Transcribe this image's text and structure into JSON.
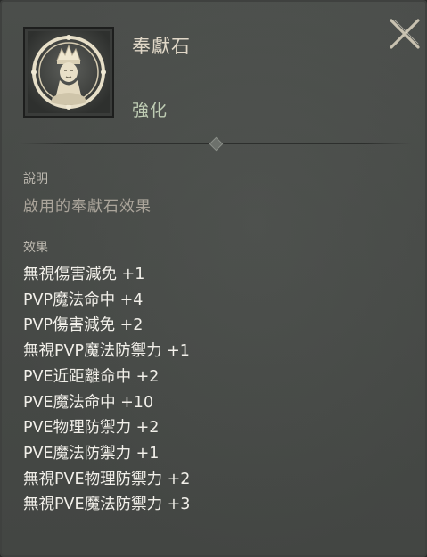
{
  "tooltip": {
    "item_name": "奉獻石",
    "item_type": "強化",
    "icon": "priest-portrait-icon",
    "close_icon": "close-icon",
    "description_label": "說明",
    "description_text": "啟用的奉獻石效果",
    "effects_label": "效果",
    "effects": [
      "無視傷害減免 +1",
      "PVP魔法命中 +4",
      "PVP傷害減免 +2",
      "無視PVP魔法防禦力 +1",
      "PVE近距離命中 +2",
      "PVE魔法命中 +10",
      "PVE物理防禦力 +2",
      "PVE魔法防禦力 +1",
      "無視PVE物理防禦力 +2",
      "無視PVE魔法防禦力 +3"
    ]
  },
  "colors": {
    "panel_bg": "#484b48",
    "title_text": "#e0d7c7",
    "type_text": "#bfcdb4",
    "effect_text": "#f2f0ea"
  }
}
